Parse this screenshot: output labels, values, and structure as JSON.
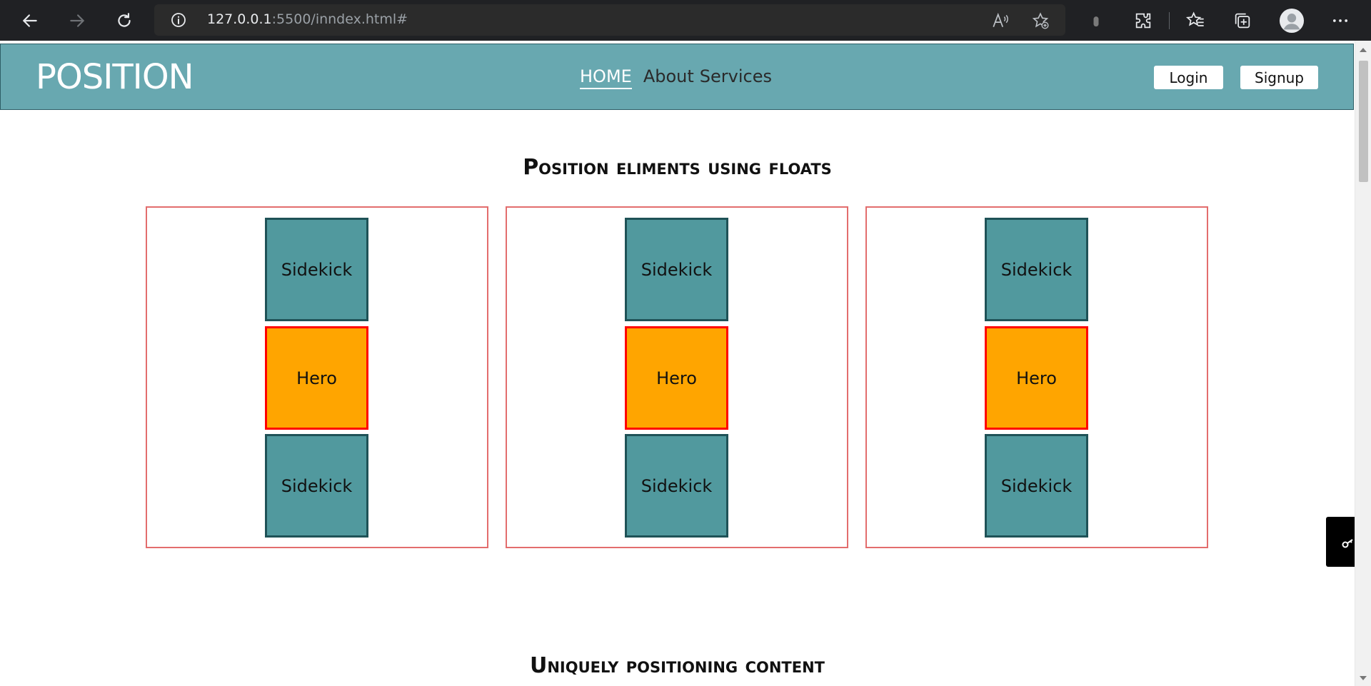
{
  "browser": {
    "url_host": "127.0.0.1",
    "url_rest": ":5500/inndex.html#",
    "icons": [
      "back-icon",
      "forward-icon",
      "reload-icon",
      "info-icon",
      "read-aloud-icon",
      "add-favorite-icon",
      "profile-dot-icon",
      "extensions-icon",
      "favorites-icon",
      "collections-icon",
      "avatar",
      "more-icon"
    ]
  },
  "header": {
    "logo": "POSITION",
    "nav": {
      "home": "HOME",
      "about": "About",
      "services": "Services"
    },
    "login": "Login",
    "signup": "Signup"
  },
  "section1": {
    "title": "Position eliments using floats",
    "boxes": [
      {
        "top": "Sidekick",
        "middle": "Hero",
        "bottom": "Sidekick"
      },
      {
        "top": "Sidekick",
        "middle": "Hero",
        "bottom": "Sidekick"
      },
      {
        "top": "Sidekick",
        "middle": "Hero",
        "bottom": "Sidekick"
      }
    ]
  },
  "section2": {
    "title": "Uniquely positioning content"
  },
  "colors": {
    "header_bg": "#68a8b0",
    "sidekick": "#51999e",
    "hero": "#ffa500",
    "hero_border": "#ff0000",
    "box_border": "#e36d6d"
  }
}
